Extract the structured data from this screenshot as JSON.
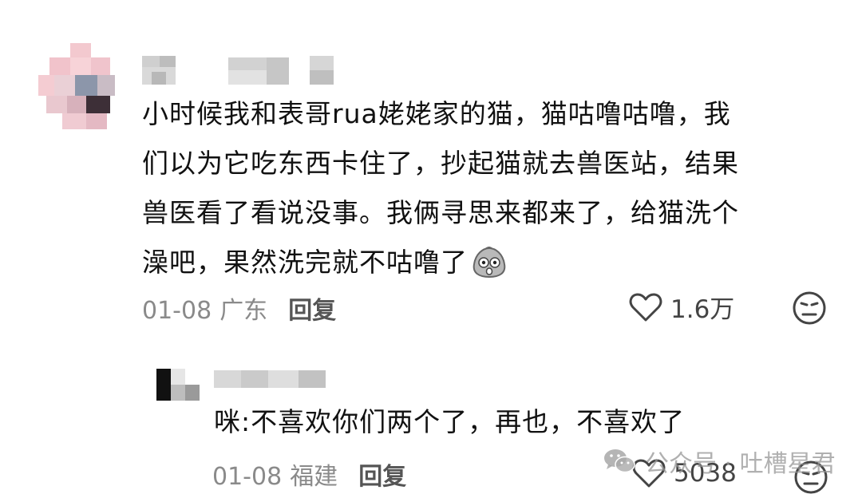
{
  "colors": {
    "text": "#111111",
    "meta": "#8a8a8a",
    "reply_label": "#555555",
    "watermark": "#9a9a9a"
  },
  "comment": {
    "text": "小时候我和表哥rua姥姥家的猫，猫咕噜咕噜，我\n们以为它吃东西卡住了，抄起猫就去兽医站，结果\n兽医看了看说没事。我俩寻思来都来了，给猫洗个\n澡吧，果然洗完就不咕噜了",
    "emoji": "shocked-face-emoji",
    "date": "01-08",
    "location": "广东",
    "reply_label": "回复",
    "likes": "1.6万",
    "like_icon": "heart-icon",
    "dislike_icon": "neutral-face-icon"
  },
  "reply": {
    "text": "咪:不喜欢你们两个了，再也，不喜欢了",
    "date": "01-08",
    "location": "福建",
    "reply_label": "回复",
    "likes": "5038",
    "like_icon": "heart-icon",
    "dislike_icon": "neutral-face-icon"
  },
  "watermark": {
    "text": "公众号 · 吐槽星君",
    "icon": "wechat-icon"
  }
}
